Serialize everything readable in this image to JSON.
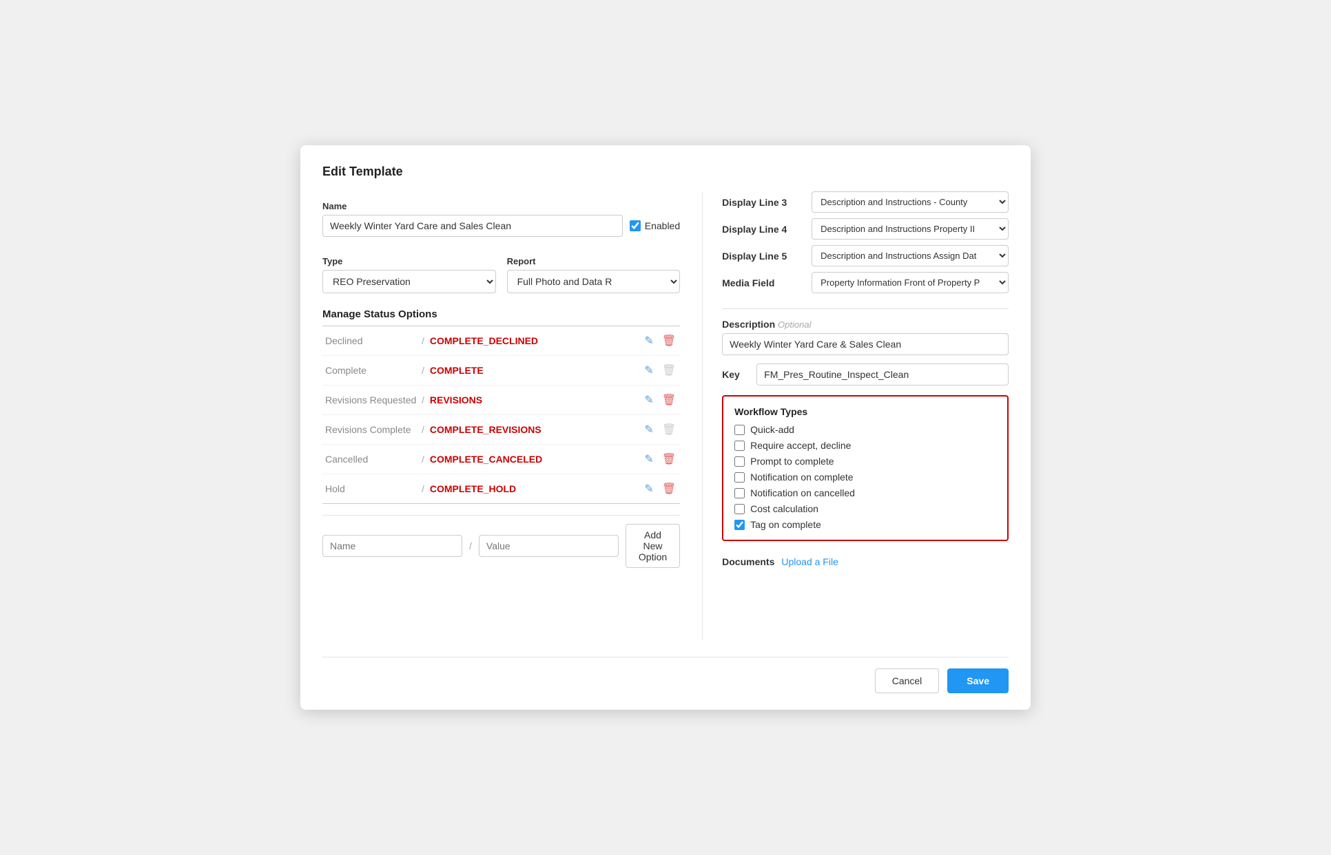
{
  "modal": {
    "title": "Edit Template"
  },
  "left": {
    "name_label": "Name",
    "name_value": "Weekly Winter Yard Care and Sales Clean",
    "enabled_label": "Enabled",
    "type_label": "Type",
    "type_value": "REO Preservation",
    "report_label": "Report",
    "report_value": "Full Photo and Data R",
    "manage_status_title": "Manage Status Options",
    "status_rows": [
      {
        "name": "Declined",
        "value": "COMPLETE_DECLINED",
        "delete_enabled": true
      },
      {
        "name": "Complete",
        "value": "COMPLETE",
        "delete_enabled": false
      },
      {
        "name": "Revisions Requested",
        "value": "REVISIONS",
        "delete_enabled": true
      },
      {
        "name": "Revisions Complete",
        "value": "COMPLETE_REVISIONS",
        "delete_enabled": false
      },
      {
        "name": "Cancelled",
        "value": "COMPLETE_CANCELED",
        "delete_enabled": true
      },
      {
        "name": "Hold",
        "value": "COMPLETE_HOLD",
        "delete_enabled": true
      }
    ],
    "add_option_name_placeholder": "Name",
    "add_option_value_placeholder": "Value",
    "add_option_btn_label": "Add New Option"
  },
  "right": {
    "display_lines": [
      {
        "label": "Display Line 3",
        "value": "Description and Instructions - County"
      },
      {
        "label": "Display Line 4",
        "value": "Description and Instructions Property II"
      },
      {
        "label": "Display Line 5",
        "value": "Description and Instructions Assign Dat"
      },
      {
        "label": "Media Field",
        "value": "Property Information Front of Property P"
      }
    ],
    "description_label": "Description",
    "description_optional": "Optional",
    "description_value": "Weekly Winter Yard Care & Sales Clean",
    "key_label": "Key",
    "key_value": "FM_Pres_Routine_Inspect_Clean",
    "workflow_title": "Workflow Types",
    "workflow_items": [
      {
        "label": "Quick-add",
        "checked": false
      },
      {
        "label": "Require accept, decline",
        "checked": false
      },
      {
        "label": "Prompt to complete",
        "checked": false
      },
      {
        "label": "Notification on complete",
        "checked": false
      },
      {
        "label": "Notification on cancelled",
        "checked": false
      },
      {
        "label": "Cost calculation",
        "checked": false
      },
      {
        "label": "Tag on complete",
        "checked": true
      }
    ],
    "documents_label": "Documents",
    "upload_link": "Upload a File"
  },
  "footer": {
    "cancel_label": "Cancel",
    "save_label": "Save"
  }
}
